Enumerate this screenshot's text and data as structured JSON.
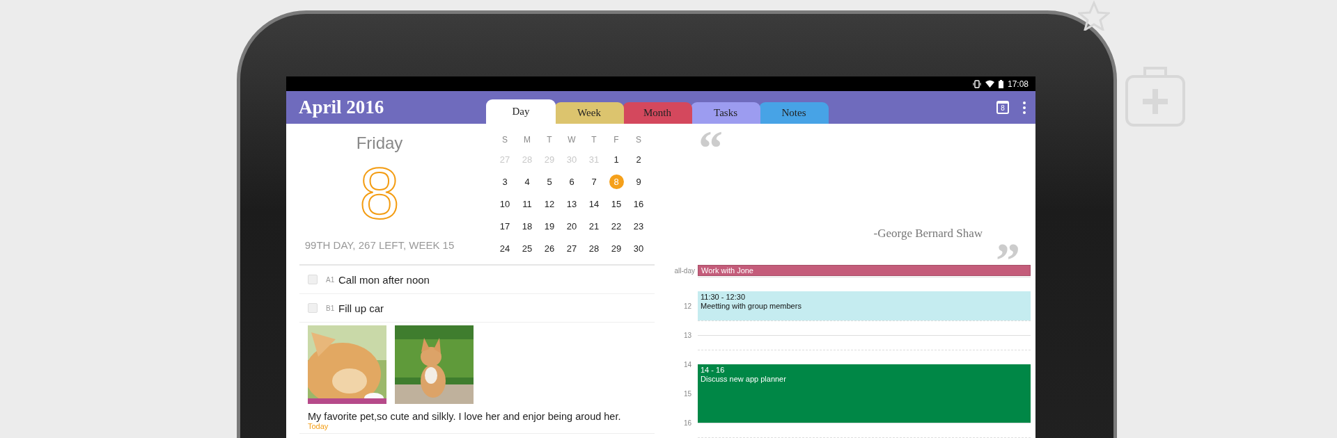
{
  "status_bar": {
    "time": "17:08"
  },
  "header": {
    "title": "April 2016",
    "today_button": "8"
  },
  "tabs": [
    {
      "label": "Day",
      "selected": true,
      "color": "#ffffff"
    },
    {
      "label": "Week",
      "selected": false,
      "color": "#dcc46e"
    },
    {
      "label": "Month",
      "selected": false,
      "color": "#d4485d"
    },
    {
      "label": "Tasks",
      "selected": false,
      "color": "#9c9cf0"
    },
    {
      "label": "Notes",
      "selected": false,
      "color": "#47a3e6"
    }
  ],
  "day_info": {
    "weekday": "Friday",
    "day": "8",
    "summary": "99TH DAY, 267 LEFT, WEEK 15"
  },
  "mini_calendar": {
    "weekdays": [
      "S",
      "M",
      "T",
      "W",
      "T",
      "F",
      "S"
    ],
    "weeks": [
      [
        {
          "d": "27",
          "other_month": true,
          "selected": false
        },
        {
          "d": "28",
          "other_month": true,
          "selected": false
        },
        {
          "d": "29",
          "other_month": true,
          "selected": false
        },
        {
          "d": "30",
          "other_month": true,
          "selected": false
        },
        {
          "d": "31",
          "other_month": true,
          "selected": false
        },
        {
          "d": "1",
          "other_month": false,
          "selected": false
        },
        {
          "d": "2",
          "other_month": false,
          "selected": false
        }
      ],
      [
        {
          "d": "3",
          "other_month": false,
          "selected": false
        },
        {
          "d": "4",
          "other_month": false,
          "selected": false
        },
        {
          "d": "5",
          "other_month": false,
          "selected": false
        },
        {
          "d": "6",
          "other_month": false,
          "selected": false
        },
        {
          "d": "7",
          "other_month": false,
          "selected": false
        },
        {
          "d": "8",
          "other_month": false,
          "selected": true
        },
        {
          "d": "9",
          "other_month": false,
          "selected": false
        }
      ],
      [
        {
          "d": "10",
          "other_month": false,
          "selected": false
        },
        {
          "d": "11",
          "other_month": false,
          "selected": false
        },
        {
          "d": "12",
          "other_month": false,
          "selected": false
        },
        {
          "d": "13",
          "other_month": false,
          "selected": false
        },
        {
          "d": "14",
          "other_month": false,
          "selected": false
        },
        {
          "d": "15",
          "other_month": false,
          "selected": false
        },
        {
          "d": "16",
          "other_month": false,
          "selected": false
        }
      ],
      [
        {
          "d": "17",
          "other_month": false,
          "selected": false
        },
        {
          "d": "18",
          "other_month": false,
          "selected": false
        },
        {
          "d": "19",
          "other_month": false,
          "selected": false
        },
        {
          "d": "20",
          "other_month": false,
          "selected": false
        },
        {
          "d": "21",
          "other_month": false,
          "selected": false
        },
        {
          "d": "22",
          "other_month": false,
          "selected": false
        },
        {
          "d": "23",
          "other_month": false,
          "selected": false
        }
      ],
      [
        {
          "d": "24",
          "other_month": false,
          "selected": false
        },
        {
          "d": "25",
          "other_month": false,
          "selected": false
        },
        {
          "d": "26",
          "other_month": false,
          "selected": false
        },
        {
          "d": "27",
          "other_month": false,
          "selected": false
        },
        {
          "d": "28",
          "other_month": false,
          "selected": false
        },
        {
          "d": "29",
          "other_month": false,
          "selected": false
        },
        {
          "d": "30",
          "other_month": false,
          "selected": false
        }
      ]
    ]
  },
  "tasks": [
    {
      "priority": "A1",
      "title": "Call mon after noon",
      "checked": false
    },
    {
      "priority": "B1",
      "title": "Fill up car",
      "checked": false
    }
  ],
  "note": {
    "text": "My favorite pet,so cute and silkly. I love her and enjor being aroud her.",
    "date": "Today"
  },
  "quote": {
    "open_mark": "“",
    "author": "-George Bernard Shaw",
    "close_mark": "”"
  },
  "agenda": {
    "all_day_label": "all-day",
    "all_day_events": [
      {
        "title": "Work with Jone",
        "color": "#c45c7a"
      }
    ],
    "hours": [
      "12",
      "13",
      "14",
      "15",
      "16"
    ],
    "events": [
      {
        "time": "11:30 - 12:30",
        "title": "Meetting with group members",
        "color": "#c5ecf0"
      },
      {
        "time": "14 - 16",
        "title": "Discuss new app planner",
        "color": "#008746"
      }
    ]
  }
}
